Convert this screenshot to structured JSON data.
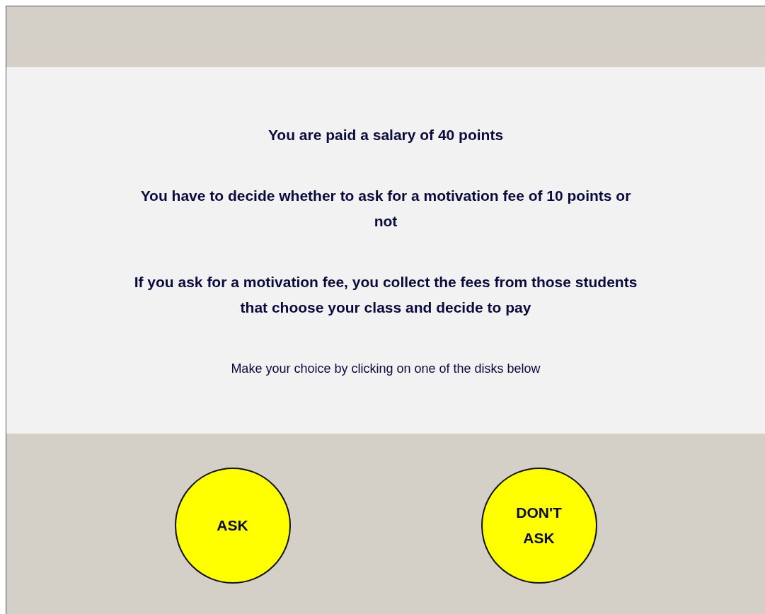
{
  "statements": [
    "You are paid a salary of 40 points",
    "You have to decide whether to ask for a motivation fee of 10 points or not",
    "If you ask for a motivation fee, you collect the fees from those students that choose your class and decide to pay"
  ],
  "instruction": "Make your choice by clicking on one of the disks below",
  "choices": [
    {
      "label": "ASK"
    },
    {
      "label": "DON'T ASK"
    }
  ]
}
